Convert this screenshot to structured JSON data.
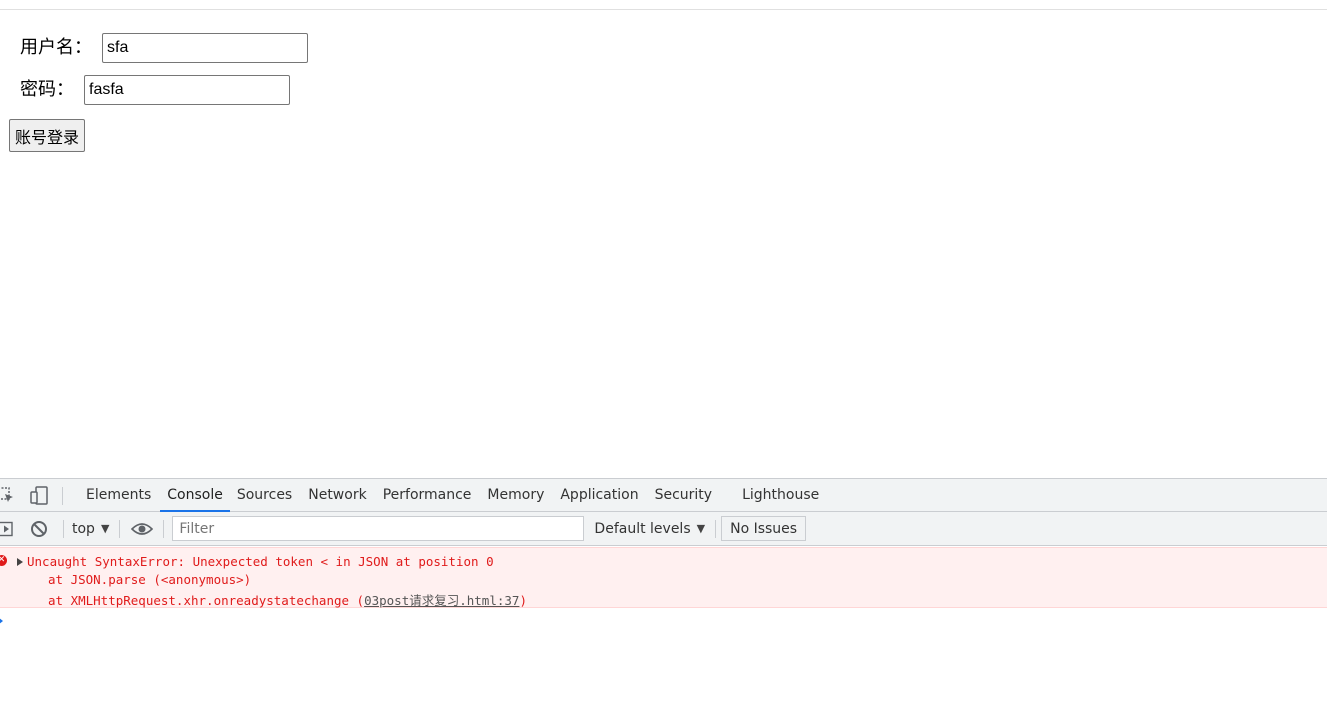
{
  "form": {
    "username_label": "用户名：",
    "username_value": "sfa",
    "password_label": "密码：",
    "password_value": "fasfa",
    "login_button": "账号登录"
  },
  "devtools": {
    "tabs": [
      {
        "label": "Elements",
        "active": false
      },
      {
        "label": "Console",
        "active": true
      },
      {
        "label": "Sources",
        "active": false
      },
      {
        "label": "Network",
        "active": false
      },
      {
        "label": "Performance",
        "active": false
      },
      {
        "label": "Memory",
        "active": false
      },
      {
        "label": "Application",
        "active": false
      },
      {
        "label": "Security",
        "active": false
      },
      {
        "label": "Lighthouse",
        "active": false
      }
    ],
    "toolbar": {
      "context": "top",
      "filter_placeholder": "Filter",
      "levels": "Default levels",
      "issues": "No Issues"
    },
    "console": {
      "error_message": "Uncaught SyntaxError: Unexpected token < in JSON at position 0",
      "stack_1": "at JSON.parse (<anonymous>)",
      "stack_2_prefix": "at XMLHttpRequest.xhr.onreadystatechange (",
      "stack_2_link": "03post请求复习.html:37",
      "stack_2_suffix": ")"
    },
    "colors": {
      "accent": "#1a73e8",
      "error": "#e01b1b",
      "error_bg": "#fff0f0"
    }
  }
}
